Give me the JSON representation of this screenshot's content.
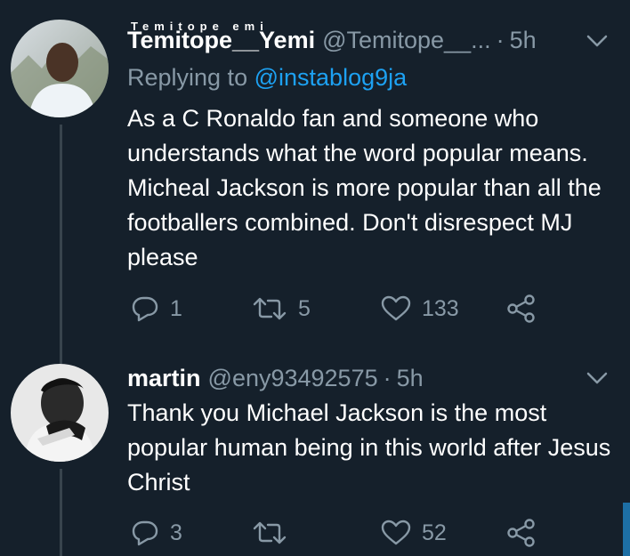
{
  "tweets": [
    {
      "display_name_small": "Temitope    emi",
      "display_name": "Temitope__Yemi",
      "handle": "@Temitope__...",
      "separator": "·",
      "time": "5h",
      "reply_prefix": "Replying to",
      "reply_to": "@instablog9ja",
      "text": "As a C Ronaldo fan and someone who understands what the word popular means. Micheal Jackson is more popular than all the footballers combined. Don't disrespect MJ please",
      "reply_count": "1",
      "retweet_count": "5",
      "like_count": "133",
      "icons": [
        "reply-icon",
        "retweet-icon",
        "like-icon",
        "share-icon",
        "chevron-down-icon"
      ]
    },
    {
      "display_name": "martin",
      "handle": "@eny93492575",
      "separator": "·",
      "time": "5h",
      "text": "Thank you Michael Jackson is the most popular human being in this world after Jesus Christ",
      "reply_count": "3",
      "retweet_count": "",
      "like_count": "52",
      "icons": [
        "reply-icon",
        "retweet-icon",
        "like-icon",
        "share-icon",
        "chevron-down-icon"
      ]
    }
  ],
  "colors": {
    "background": "#15202b",
    "primary_text": "#ffffff",
    "secondary_text": "#8899a6",
    "link": "#1da1f2",
    "thread_line": "#38444d"
  }
}
